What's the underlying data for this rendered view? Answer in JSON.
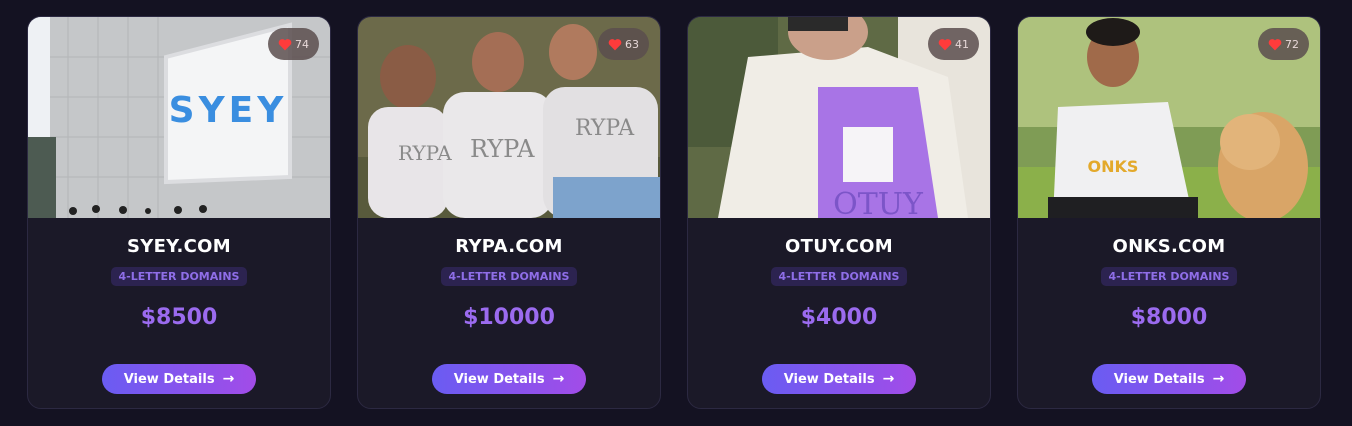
{
  "cards": [
    {
      "name": "SYEY.COM",
      "tag": "4-LETTER DOMAINS",
      "price": "$8500",
      "likes": "74",
      "button": "View Details",
      "logo": "SYEY"
    },
    {
      "name": "RYPA.COM",
      "tag": "4-LETTER DOMAINS",
      "price": "$10000",
      "likes": "63",
      "button": "View Details",
      "logo": "RYPA"
    },
    {
      "name": "OTUY.COM",
      "tag": "4-LETTER DOMAINS",
      "price": "$4000",
      "likes": "41",
      "button": "View Details",
      "logo": "OTUY"
    },
    {
      "name": "ONKS.COM",
      "tag": "4-LETTER DOMAINS",
      "price": "$8000",
      "likes": "72",
      "button": "View Details",
      "logo": "ONKS"
    }
  ],
  "icons": {
    "like": "heart-icon",
    "button": "arrow-right-icon"
  },
  "colors": {
    "background": "#141222",
    "card": "#1b1928",
    "price": "#9b6bef",
    "button_start": "#6a5cf2",
    "button_end": "#a24ce8",
    "heart": "#ff3b3b"
  }
}
